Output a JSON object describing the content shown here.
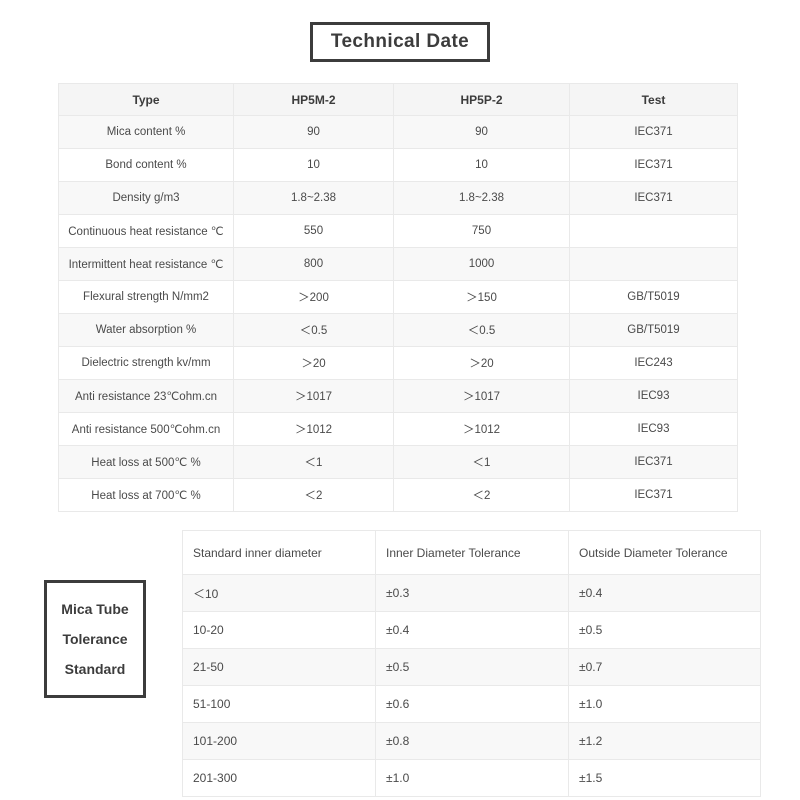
{
  "title": {
    "text": "Technical Date"
  },
  "spec_table": {
    "headers": [
      "Type",
      "HP5M-2",
      "HP5P-2",
      "Test"
    ],
    "rows": [
      [
        "Mica content  %",
        "90",
        "90",
        "IEC371"
      ],
      [
        "Bond content  %",
        "10",
        "10",
        "IEC371"
      ],
      [
        "Density  g/m3",
        "1.8~2.38",
        "1.8~2.38",
        "IEC371"
      ],
      [
        "Continuous heat resistance ℃",
        "550",
        "750",
        ""
      ],
      [
        "Intermittent heat resistance ℃",
        "800",
        "1000",
        ""
      ],
      [
        "Flexural strength  N/mm2",
        "＞200",
        "＞150",
        "GB/T5019"
      ],
      [
        "Water absorption  %",
        "＜0.5",
        "＜0.5",
        "GB/T5019"
      ],
      [
        "Dielectric strength  kv/mm",
        "＞20",
        "＞20",
        "IEC243"
      ],
      [
        "Anti resistance  23℃ohm.cn",
        "＞1017",
        "＞1017",
        "IEC93"
      ],
      [
        "Anti resistance  500℃ohm.cn",
        "＞1012",
        "＞1012",
        "IEC93"
      ],
      [
        "Heat loss  at 500℃  %",
        "＜1",
        "＜1",
        "IEC371"
      ],
      [
        "Heat loss  at 700℃  %",
        "＜2",
        "＜2",
        "IEC371"
      ]
    ]
  },
  "tolerance_label": {
    "line1": "Mica Tube",
    "line2": "Tolerance",
    "line3": "Standard"
  },
  "tolerance_table": {
    "headers": [
      "Standard inner diameter",
      "Inner Diameter Tolerance",
      "Outside Diameter Tolerance"
    ],
    "rows": [
      [
        "＜10",
        "±0.3",
        "±0.4"
      ],
      [
        "10-20",
        "±0.4",
        "±0.5"
      ],
      [
        "21-50",
        "±0.5",
        "±0.7"
      ],
      [
        "51-100",
        "±0.6",
        "±1.0"
      ],
      [
        "101-200",
        "±0.8",
        "±1.2"
      ],
      [
        "201-300",
        "±1.0",
        "±1.5"
      ]
    ]
  }
}
